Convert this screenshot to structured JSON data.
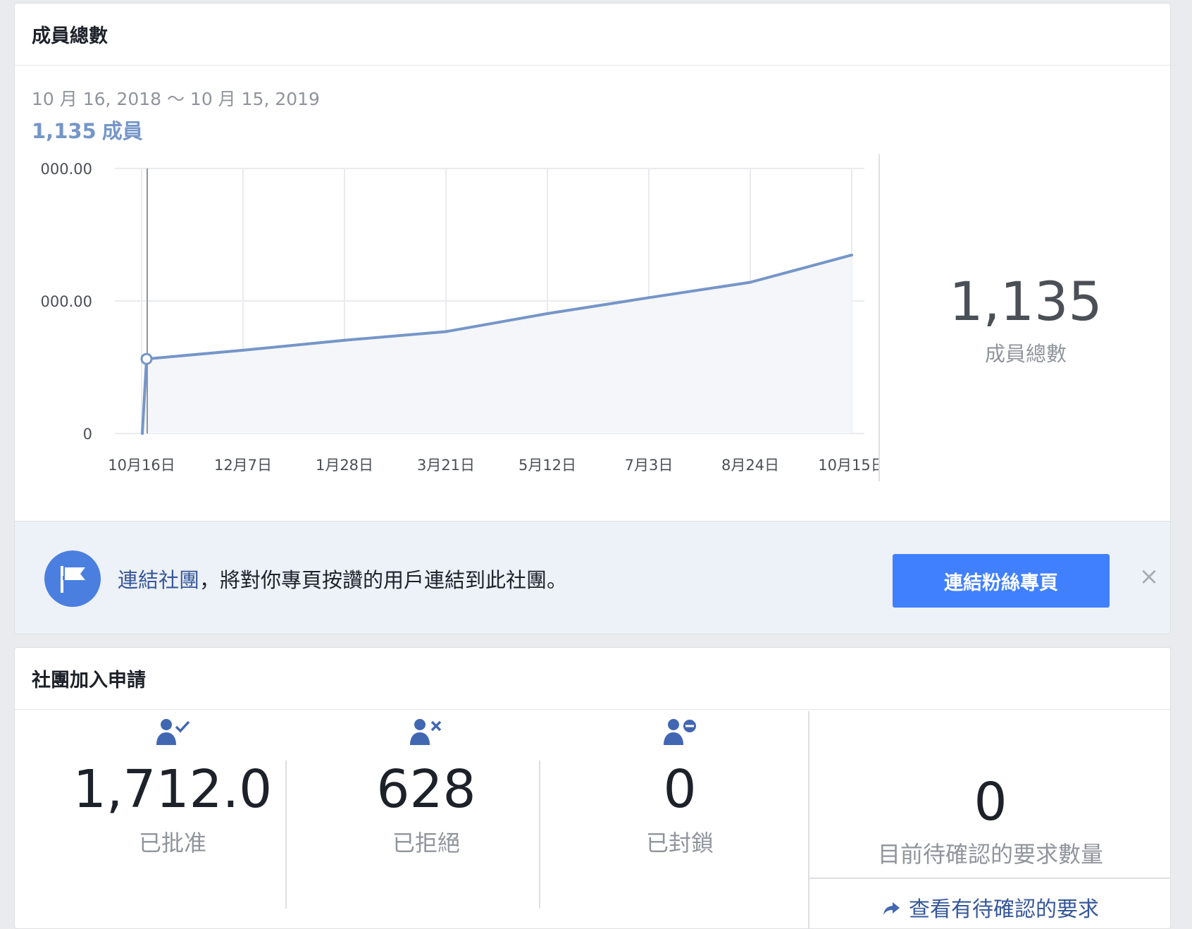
{
  "members_card": {
    "title": "成員總數",
    "date_range": "10 月 16, 2018 ～ 10 月 15, 2019",
    "member_count": "1,135",
    "member_unit": "成員",
    "total": "1,135",
    "total_label": "成員總數"
  },
  "chart_data": {
    "type": "area",
    "y_tick_labels": [
      "000.00",
      "000.00",
      "0"
    ],
    "x_tick_labels": [
      "10月16日",
      "12月7日",
      "1月28日",
      "3月21日",
      "5月12日",
      "7月3日",
      "8月24日",
      "10月15日"
    ],
    "x": [
      "10月16日",
      "10月17日",
      "12月7日",
      "1月28日",
      "3月21日",
      "5月12日",
      "7月3日",
      "8月24日",
      "10月15日"
    ],
    "series": [
      {
        "values": [
          0,
          560,
          625,
          700,
          765,
          900,
          1020,
          1135,
          1340
        ]
      }
    ],
    "ylim": [
      0,
      1990
    ],
    "grid": true,
    "color": "#7596c8"
  },
  "banner": {
    "link_text": "連結社團",
    "text": "，將對你專頁按讚的用戶連結到此社團。",
    "button_label": "連結粉絲專頁",
    "close_symbol": "×"
  },
  "requests_card": {
    "title": "社團加入申請",
    "approved": {
      "value": "1,712.0",
      "label": "已批准",
      "icon": "user-check-icon"
    },
    "declined": {
      "value": "628",
      "label": "已拒絕",
      "icon": "user-x-icon"
    },
    "blocked": {
      "value": "0",
      "label": "已封鎖",
      "icon": "user-minus-icon"
    },
    "pending": {
      "value": "0",
      "label": "目前待確認的要求數量",
      "link": "查看有待確認的要求"
    }
  },
  "colors": {
    "accent": "#4080ff",
    "link": "#365899",
    "chart_line": "#7596c8",
    "icon_blue": "#4267b2"
  }
}
